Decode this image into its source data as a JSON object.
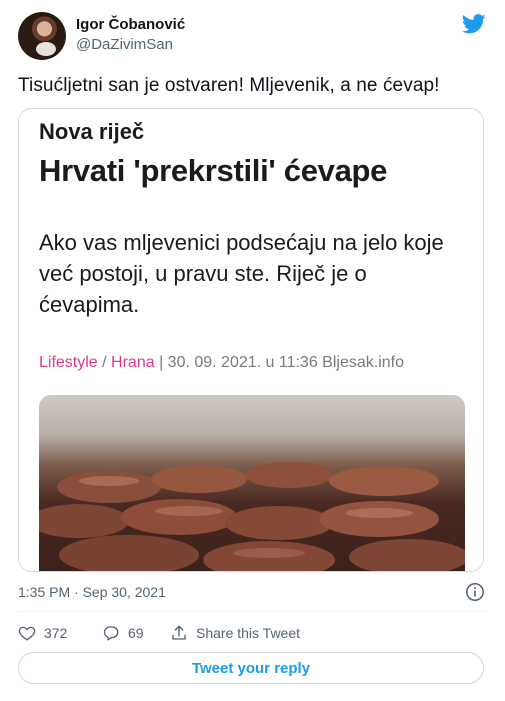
{
  "author": {
    "name": "Igor Čobanović",
    "handle": "@DaZivimSan"
  },
  "tweet": {
    "text": "Tisućljetni san je ostvaren! Mljevenik, a ne ćevap!",
    "timestamp": "1:35 PM · Sep 30, 2021"
  },
  "card": {
    "kicker": "Nova riječ",
    "headline": "Hrvati 'prekrstili' ćevape",
    "lede": "Ako vas mljevenici podsećaju na jelo koje već postoji, u pravu ste. Riječ je o ćevapima.",
    "meta": {
      "category": "Lifestyle",
      "separator": " / ",
      "subcategory": "Hrana",
      "rest": " | 30. 09. 2021. u 11:36 Bljesak.info"
    }
  },
  "stats": {
    "likes": "372",
    "replies": "69",
    "share_label": "Share this Tweet"
  },
  "reply_button_label": "Tweet your reply",
  "icons": {
    "brand": "twitter-bird-icon",
    "info": "info-icon",
    "like": "heart-icon",
    "reply": "reply-bubble-icon",
    "share": "share-icon"
  },
  "colors": {
    "accent": "#1d9bf0",
    "category": "#e0398a",
    "muted": "#536471"
  }
}
